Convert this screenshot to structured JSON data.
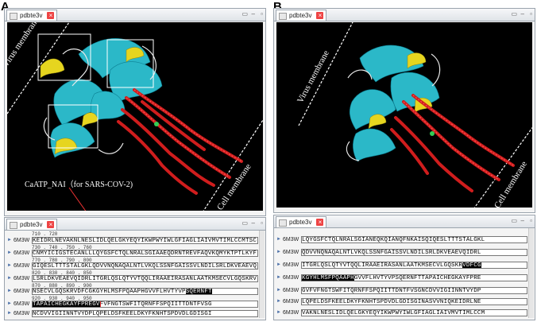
{
  "panels": {
    "a": {
      "letter": "A",
      "top_window": {
        "tab_title": "pdbte3v"
      },
      "annotation": "CaATP_NAI（for SARS-COV-2)",
      "membrane_labels": {
        "virus": "Virus membrane",
        "cell": "Cell membrane"
      },
      "bottom_window": {
        "tab_title": "pdbte3v",
        "rows": [
          {
            "chain": "6M3W",
            "numbers": "710  .  720",
            "seq": "KEIDRLNEVAKNLNESLIDLQELGKYEQYIKWPWYIWLGFIAGLIAIVMVTIMLCCMTSC"
          },
          {
            "chain": "6M3W",
            "numbers": "730  .  740  .  750  .  760",
            "seq": "CNMYICIGSTECANLLLQYGSFCTQLNRALSGIAAEQDRNTREVFAQVKQMYKTPTLKYF"
          },
          {
            "chain": "6M3W",
            "numbers": "770  .  780  .  790  .  800",
            "seq": "GIQESLTTTSTALGKLQDVVNQNAQALNTLVKQLSSNFGAISSVLNDILSRLDKVEAEVQ"
          },
          {
            "chain": "6M3W",
            "numbers": "820  .  830  .  840  .  850",
            "seq": "LSRLDKVEAEVQIDRLITGRLQSLQTYVTQQLIRAAEIRASANLAATKMSECVLGQSKRV"
          },
          {
            "chain": "6M3W",
            "numbers": "870  .  880  .  890  .  900",
            "seq": "NSECVLGQSKRVDFCGKGYHLMSFPQAAPHGVVFLHVTYVP",
            "hl": "SQERNFT"
          },
          {
            "chain": "6M3W",
            "numbers": "920  .  930  .  940  .  950",
            "pre": "",
            "hl_red": "TAPAICHEGKAYFPREGV",
            "seq": "FVFNGTSWFITQRNFFSPQIITTDNTFVSG"
          },
          {
            "chain": "6M3W",
            "numbers": "",
            "seq": "NCDVVIGIINNTVYDPLQPELDSFKEELDKYFKNHTSPDVDLGDISGI"
          }
        ]
      }
    },
    "b": {
      "letter": "B",
      "top_window": {
        "tab_title": "pdbte3v"
      },
      "membrane_labels": {
        "virus": "Virus membrane",
        "cell": "Cell membrane"
      },
      "bottom_window": {
        "tab_title": "pdbte3v",
        "rows": [
          {
            "chain": "6M3W",
            "numbers": "",
            "seq": "LQYGSFCTQLNRALSGIANEQKQIANQFNKAISQIQESLTTTSTALGKL"
          },
          {
            "chain": "6M3W",
            "numbers": "",
            "seq": "QDVVNQNAQALNTLVKQLSSNFGAISSVLNDILSRLDKVEAEVQIDRL"
          },
          {
            "chain": "6M3W",
            "numbers": "",
            "seq": "ITGRLQSLQTYVTQQLIRAAEIRASANLAATKMSECVLGQSKR",
            "hl": "VDFCG"
          },
          {
            "chain": "6M3W",
            "numbers": "",
            "hl_pre": "KGYHLMSFPQAAPH",
            "seq": "GVVFLHVTYVPSQERNFTTAPAICHEGKAYFPRE"
          },
          {
            "chain": "6M3W",
            "numbers": "",
            "seq": "GVFVFNGTSWFITQRNFFSPQIITTDNTFVSGNCDVVIGIINNTVYDP"
          },
          {
            "chain": "6M3W",
            "numbers": "",
            "seq": "LQPELDSFKEELDKYFKNHTSPDVDLGDISGINASVVNIQKEIDRLNE"
          },
          {
            "chain": "6M3W",
            "numbers": "",
            "seq": "VAKNLNESLIDLQELGKYEQYIKWPWYIWLGFIAGLIAIVMVTIMLCCM"
          }
        ]
      }
    }
  }
}
